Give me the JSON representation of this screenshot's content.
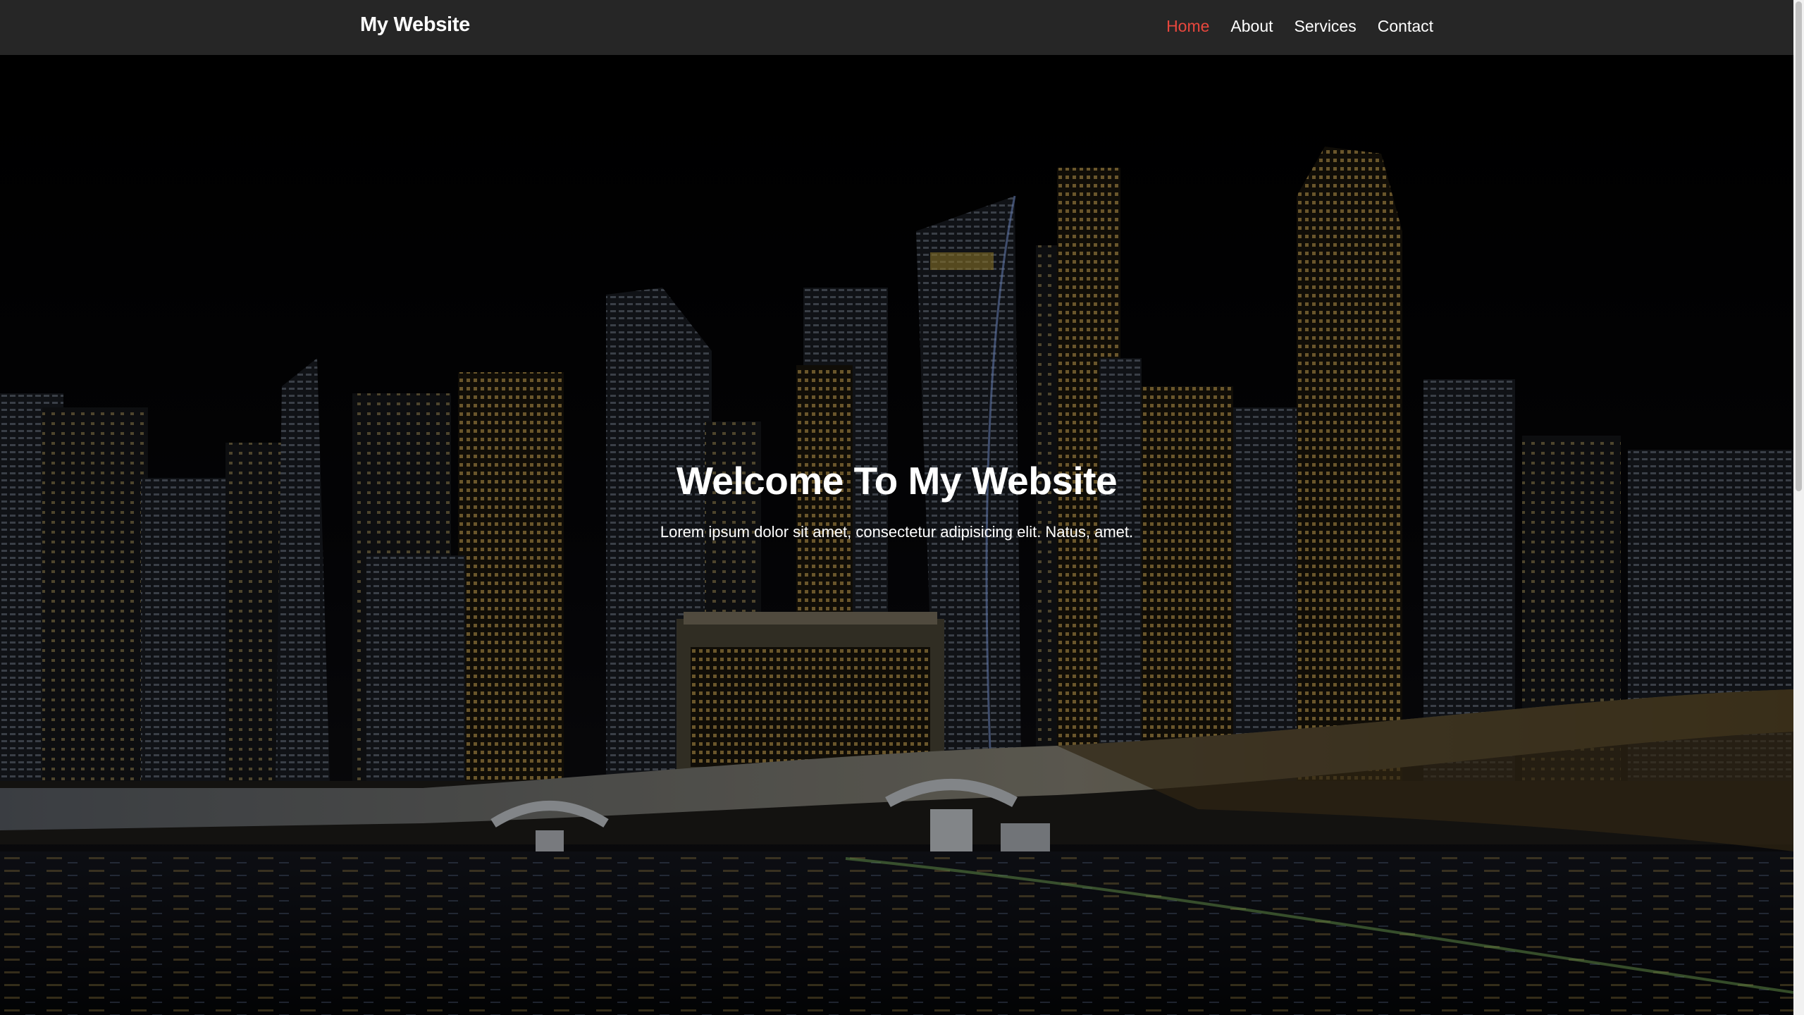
{
  "navbar": {
    "brand": "My Website",
    "links": [
      {
        "label": "Home",
        "active": true
      },
      {
        "label": "About",
        "active": false
      },
      {
        "label": "Services",
        "active": false
      },
      {
        "label": "Contact",
        "active": false
      }
    ],
    "background": "#262626",
    "active_color": "#e8473d"
  },
  "hero": {
    "title": "Welcome To My Website",
    "subtitle": "Lorem ipsum dolor sit amet, consectetur adipisicing elit. Natus, amet.",
    "background_image": "city-skyline-night-photo"
  }
}
